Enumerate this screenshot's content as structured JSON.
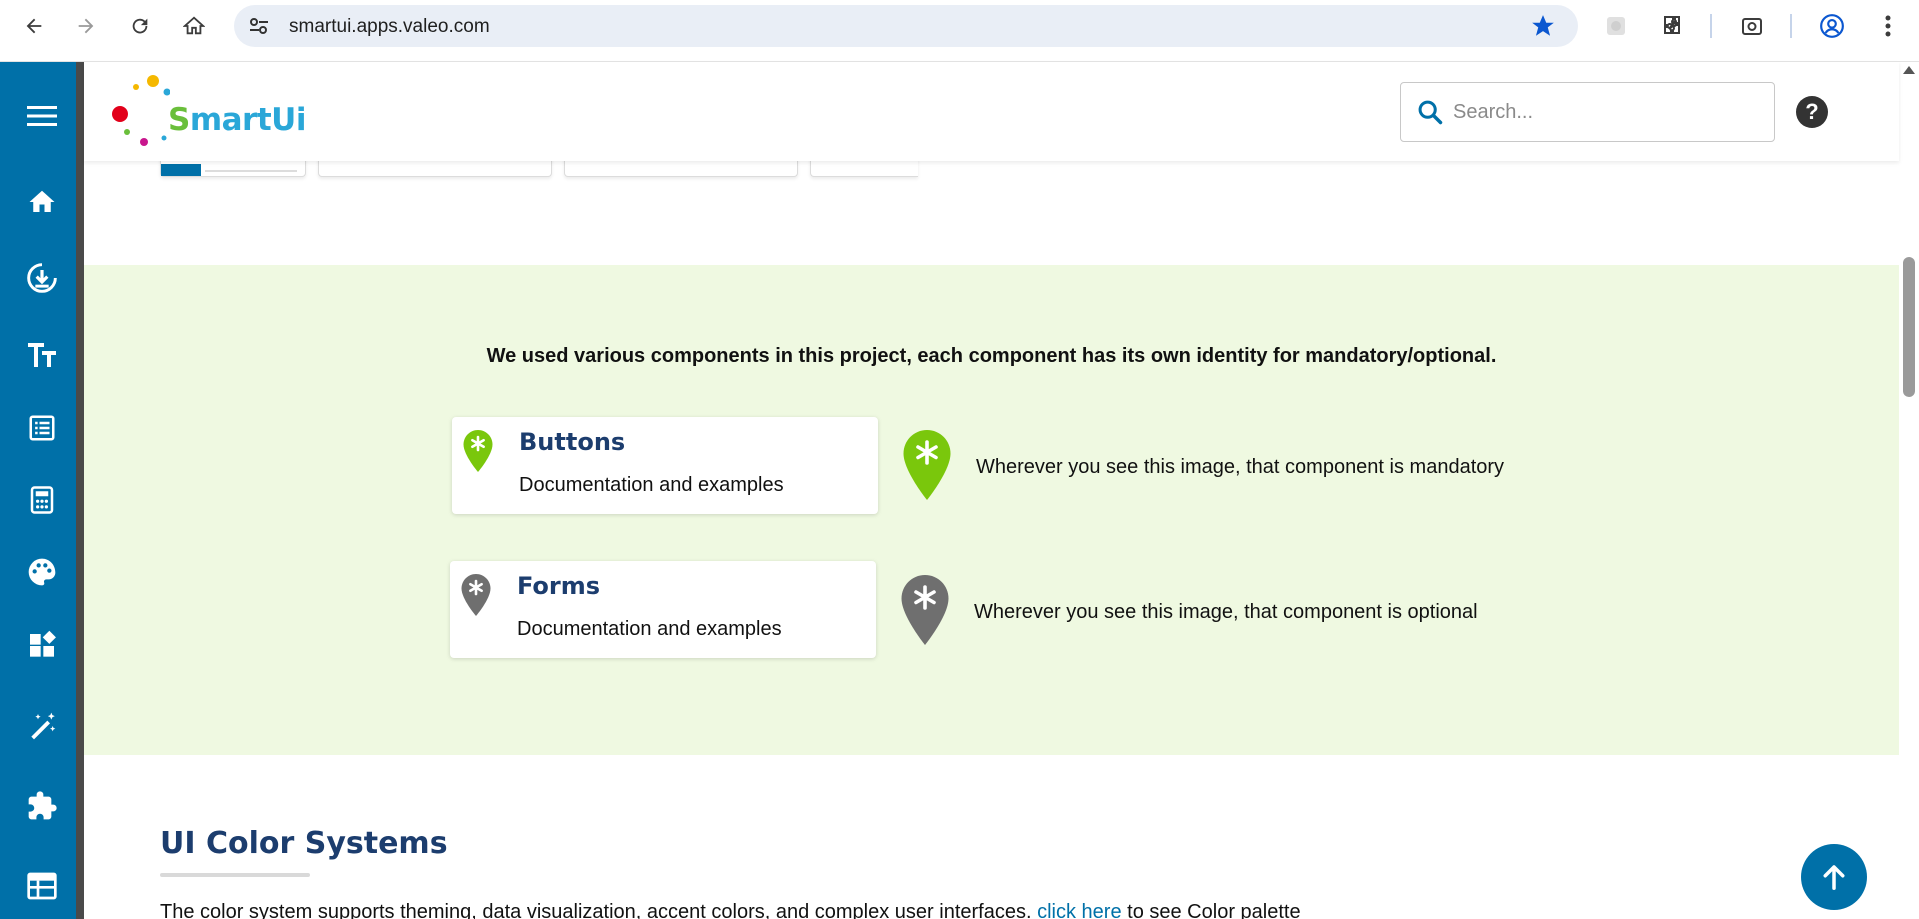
{
  "browser": {
    "url": "smartui.apps.valeo.com",
    "icons": [
      "back-arrow-icon",
      "forward-arrow-icon",
      "reload-icon",
      "home-icon",
      "site-info-icon",
      "bookmark-star-icon",
      "extension-icon",
      "puzzle-icon",
      "screenshot-icon",
      "profile-icon",
      "kebab-menu-icon"
    ]
  },
  "sidebar": {
    "items": [
      {
        "name": "menu",
        "icon": "hamburger-icon"
      },
      {
        "name": "home",
        "icon": "home-icon"
      },
      {
        "name": "download",
        "icon": "download-circle-icon"
      },
      {
        "name": "typography",
        "icon": "text-size-icon"
      },
      {
        "name": "forms",
        "icon": "list-form-icon"
      },
      {
        "name": "calculator",
        "icon": "calculator-icon"
      },
      {
        "name": "palette",
        "icon": "palette-icon"
      },
      {
        "name": "widgets",
        "icon": "widgets-icon"
      },
      {
        "name": "magic",
        "icon": "magic-wand-icon"
      },
      {
        "name": "extensions",
        "icon": "puzzle-icon"
      },
      {
        "name": "table",
        "icon": "table-icon"
      }
    ]
  },
  "header": {
    "logo_text_prefix": "S",
    "logo_text_rest": "martUi",
    "search_placeholder": "Search...",
    "help_label": "?"
  },
  "main": {
    "intro": "We used various components in this project, each component has its own identity for mandatory/optional.",
    "cards": [
      {
        "title": "Buttons",
        "description": "Documentation and examples",
        "status": "mandatory"
      },
      {
        "title": "Forms",
        "description": "Documentation and examples",
        "status": "optional"
      }
    ],
    "legend": {
      "mandatory_text": "Wherever you see this image, that component is mandatory",
      "optional_text": "Wherever you see this image, that component is optional"
    },
    "color_section": {
      "title": "UI Color Systems",
      "body_before": "The color system supports theming, data visualization, accent colors, and complex user interfaces.",
      "link_text": "click here",
      "body_after": "to see Color palette"
    }
  },
  "colors": {
    "sidebar": "#0070a8",
    "green_band": "#eff9e1",
    "mandatory_pin": "#7ac70c",
    "optional_pin": "#6f6f6f",
    "heading": "#1c3d6e",
    "link": "#0070a8"
  }
}
